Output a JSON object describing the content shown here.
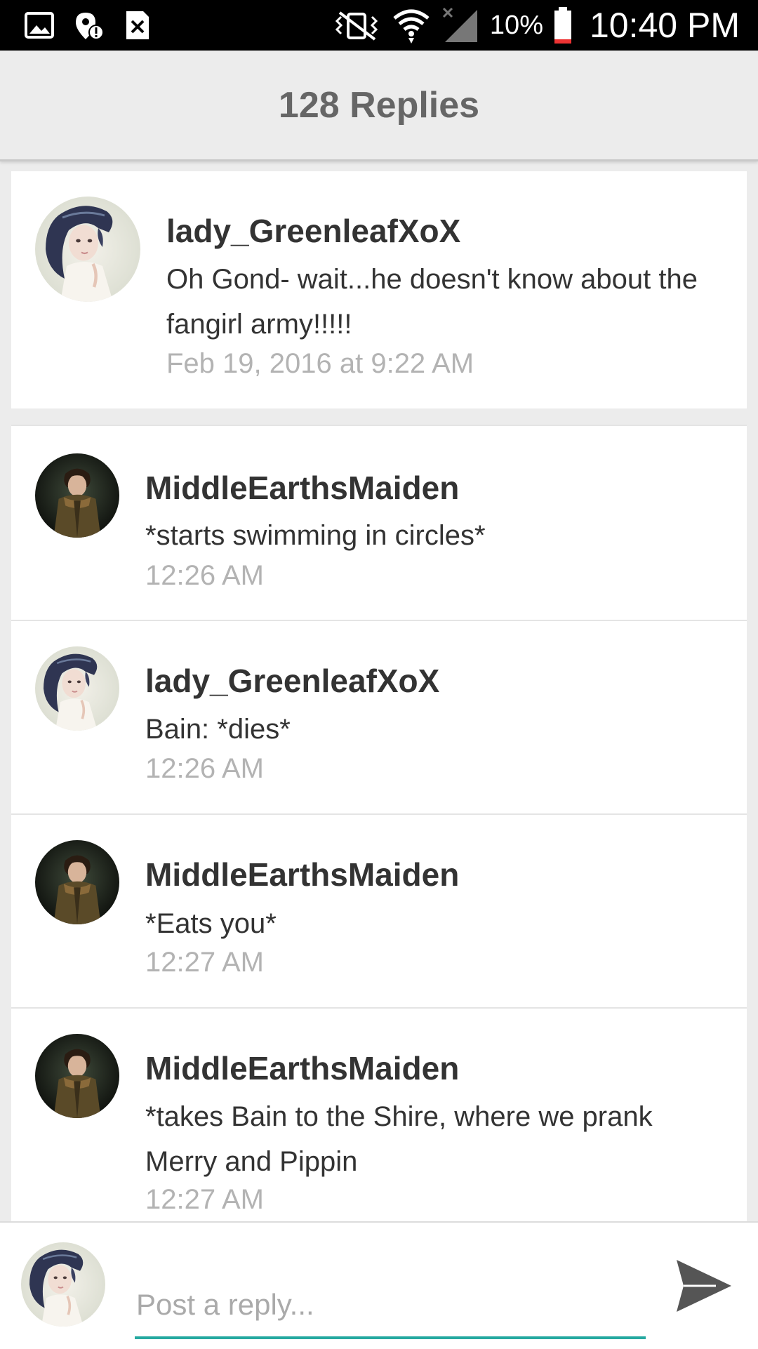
{
  "status_bar": {
    "battery_percent": "10%",
    "time": "10:40 PM",
    "left_icons": [
      "image-icon",
      "location-alert-icon",
      "close-box-icon"
    ],
    "right_icons": [
      "vibrate-icon",
      "wifi-icon",
      "signal-icon",
      "battery-icon"
    ]
  },
  "header": {
    "title": "128 Replies"
  },
  "original_post": {
    "username": "lady_GreenleafXoX",
    "text": "Oh Gond- wait...he doesn't know about the fangirl army!!!!!",
    "timestamp": "Feb 19, 2016 at 9:22 AM",
    "avatar": "avatar-girl"
  },
  "replies": [
    {
      "username": "MiddleEarthsMaiden",
      "text": "*starts swimming in circles*",
      "timestamp": "12:26 AM",
      "avatar": "avatar-boy"
    },
    {
      "username": "lady_GreenleafXoX",
      "text": "Bain: *dies*",
      "timestamp": "12:26 AM",
      "avatar": "avatar-girl"
    },
    {
      "username": "MiddleEarthsMaiden",
      "text": "*Eats you*",
      "timestamp": "12:27 AM",
      "avatar": "avatar-boy"
    },
    {
      "username": "MiddleEarthsMaiden",
      "text": "*takes Bain to the Shire, where we prank Merry and Pippin",
      "timestamp": "12:27 AM",
      "avatar": "avatar-boy"
    }
  ],
  "reply_bar": {
    "placeholder": "Post a reply...",
    "value": "",
    "send_icon": "send-icon",
    "accent_color": "#25a9a0"
  }
}
